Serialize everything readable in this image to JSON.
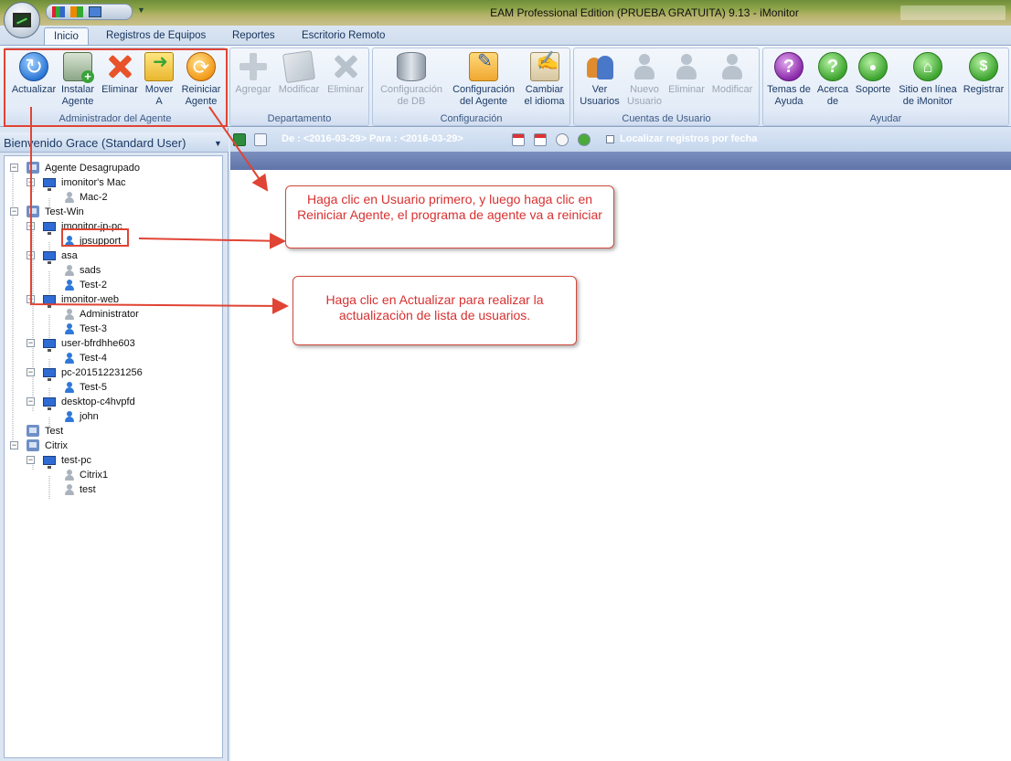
{
  "window": {
    "title": "EAM Professional Edition (PRUEBA GRATUITA) 9.13 - iMonitor"
  },
  "tabs": [
    {
      "label": "Inicio",
      "active": true
    },
    {
      "label": "Registros de Equipos"
    },
    {
      "label": "Reportes"
    },
    {
      "label": "Escritorio Remoto"
    }
  ],
  "ribbon": {
    "groups": {
      "agent_admin": "Administrador del Agente",
      "department": "Departamento",
      "configuration": "Configuración",
      "user_accounts": "Cuentas de Usuario",
      "help": "Ayudar"
    },
    "buttons": {
      "refresh": [
        "Actualizar",
        ""
      ],
      "install": [
        "Instalar",
        "Agente"
      ],
      "delete": [
        "Eliminar",
        ""
      ],
      "move": [
        "Mover",
        "A"
      ],
      "restart": [
        "Reiniciar",
        "Agente"
      ],
      "dept_add": [
        "Agregar",
        ""
      ],
      "dept_modify": [
        "Modificar",
        ""
      ],
      "dept_delete": [
        "Eliminar",
        ""
      ],
      "db_config": [
        "Configuración",
        "de DB"
      ],
      "agent_config": [
        "Configuración",
        "del Agente"
      ],
      "language": [
        "Cambiar",
        "el idioma"
      ],
      "view_users": [
        "Ver",
        "Usuarios"
      ],
      "new_user": [
        "Nuevo",
        "Usuario"
      ],
      "delete_user": [
        "Eliminar",
        ""
      ],
      "modify_user": [
        "Modificar",
        ""
      ],
      "help_topics": [
        "Temas de",
        "Ayuda"
      ],
      "about": [
        "Acerca",
        "de"
      ],
      "support": [
        "Soporte",
        ""
      ],
      "website": [
        "Sitio en línea",
        "de iMonitor"
      ],
      "register": [
        "Registrar",
        ""
      ]
    }
  },
  "left_panel": {
    "header": "Bienvenido Grace (Standard User)",
    "tree": [
      {
        "label": "Agente Desagrupado",
        "type": "group"
      },
      {
        "label": "imonitor's Mac",
        "type": "computer"
      },
      {
        "label": "Mac-2",
        "type": "user-offline"
      },
      {
        "label": "Test-Win",
        "type": "group"
      },
      {
        "label": "imonitor-jp-pc",
        "type": "computer"
      },
      {
        "label": "jpsupport",
        "type": "user-online"
      },
      {
        "label": "asa",
        "type": "computer"
      },
      {
        "label": "sads",
        "type": "user-offline"
      },
      {
        "label": "Test-2",
        "type": "user-online"
      },
      {
        "label": "imonitor-web",
        "type": "computer"
      },
      {
        "label": "Administrator",
        "type": "user-offline"
      },
      {
        "label": "Test-3",
        "type": "user-online"
      },
      {
        "label": "user-bfrdhhe603",
        "type": "computer"
      },
      {
        "label": "Test-4",
        "type": "user-online"
      },
      {
        "label": "pc-201512231256",
        "type": "computer"
      },
      {
        "label": "Test-5",
        "type": "user-online"
      },
      {
        "label": "desktop-c4hvpfd",
        "type": "computer"
      },
      {
        "label": "john",
        "type": "user-online"
      },
      {
        "label": "Test",
        "type": "group"
      },
      {
        "label": "Citrix",
        "type": "group"
      },
      {
        "label": "test-pc",
        "type": "computer"
      },
      {
        "label": "Citrix1",
        "type": "user-offline"
      },
      {
        "label": "test",
        "type": "user-offline"
      }
    ]
  },
  "toolbar": {
    "date_range": "De : <2016-03-29> Para : <2016-03-29>",
    "locate_label": "Localizar registros por fecha"
  },
  "annotations": {
    "callout_restart": "Haga clic en Usuario primero, y luego haga clic en Reiniciar Agente, el programa de agente va a reiniciar",
    "callout_refresh": "Haga clic en Actualizar para realizar la actualizaciòn de lista de usuarios."
  },
  "colors": {
    "annotation_red": "#e04434",
    "ribbon_text": "#1d3b66",
    "panel_bg": "#dce6f3"
  }
}
